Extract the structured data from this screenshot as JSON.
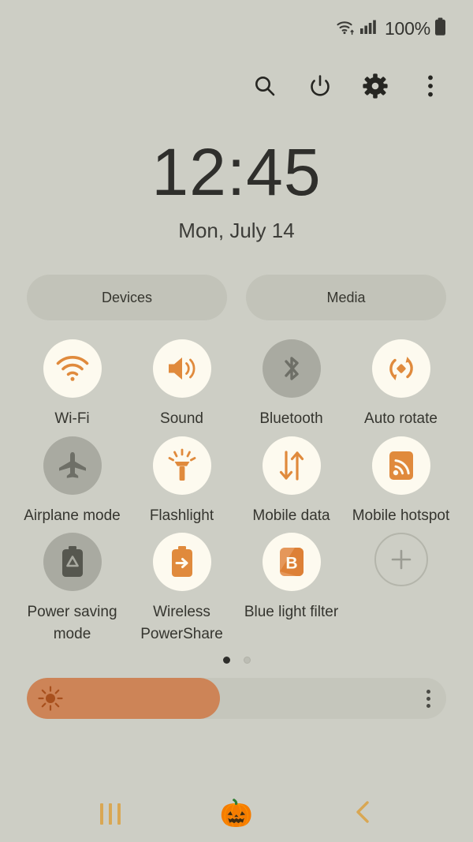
{
  "status_bar": {
    "wifi_icon": "wifi-transfer-icon",
    "signal_icon": "cellular-signal-icon",
    "battery_percent": "100%",
    "battery_icon": "battery-full-icon"
  },
  "header": {
    "search_icon": "search-icon",
    "power_icon": "power-icon",
    "settings_icon": "gear-icon",
    "overflow_icon": "more-vertical-icon"
  },
  "clock": {
    "time": "12:45",
    "date": "Mon, July 14"
  },
  "pills": [
    {
      "label": "Devices",
      "name": "devices-button"
    },
    {
      "label": "Media",
      "name": "media-button"
    }
  ],
  "tiles": [
    {
      "label": "Wi-Fi",
      "icon": "wifi-icon",
      "state": "on",
      "name": "tile-wifi"
    },
    {
      "label": "Sound",
      "icon": "speaker-icon",
      "state": "on",
      "name": "tile-sound"
    },
    {
      "label": "Bluetooth",
      "icon": "bluetooth-icon",
      "state": "off",
      "name": "tile-bluetooth"
    },
    {
      "label": "Auto rotate",
      "icon": "auto-rotate-icon",
      "state": "on",
      "name": "tile-auto-rotate"
    },
    {
      "label": "Airplane mode",
      "icon": "airplane-icon",
      "state": "off",
      "name": "tile-airplane-mode"
    },
    {
      "label": "Flashlight",
      "icon": "flashlight-icon",
      "state": "on",
      "name": "tile-flashlight"
    },
    {
      "label": "Mobile data",
      "icon": "data-arrows-icon",
      "state": "on",
      "name": "tile-mobile-data"
    },
    {
      "label": "Mobile hotspot",
      "icon": "hotspot-icon",
      "state": "on",
      "name": "tile-mobile-hotspot"
    },
    {
      "label": "Power saving mode",
      "icon": "battery-recycle-icon",
      "state": "off",
      "name": "tile-power-saving-mode"
    },
    {
      "label": "Wireless PowerShare",
      "icon": "powershare-icon",
      "state": "on",
      "name": "tile-wireless-powershare"
    },
    {
      "label": "Blue light filter",
      "icon": "blue-light-icon",
      "state": "on",
      "name": "tile-blue-light-filter"
    },
    {
      "label": "",
      "icon": "plus-icon",
      "state": "add",
      "name": "tile-add-button"
    }
  ],
  "pagination": {
    "total": 2,
    "active_index": 0
  },
  "brightness": {
    "value_percent": 46,
    "sun_icon": "brightness-sun-icon",
    "menu_icon": "more-vertical-icon"
  },
  "navbar": {
    "recents_label": "recents-button",
    "home_glyph": "🎃",
    "back_label": "back-button"
  },
  "colors": {
    "background": "#cdcec5",
    "accent_orange": "#e08a3c",
    "tile_on": "#fdfaef",
    "tile_off": "#a9aaa1",
    "slider_fill": "#cd8457",
    "nav_gold": "#d9a753"
  }
}
